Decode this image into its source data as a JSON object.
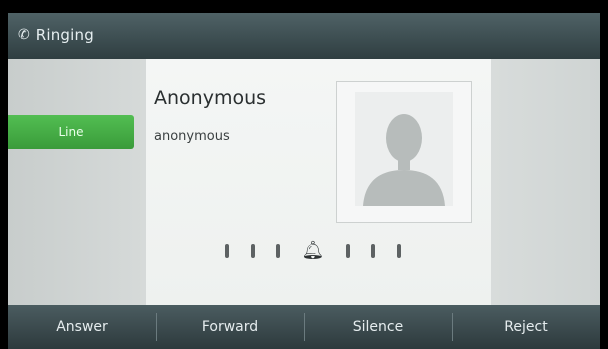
{
  "statusbar": {
    "icon": "phone-icon",
    "title": "Ringing"
  },
  "sidebar": {
    "tab_label": "Line"
  },
  "caller": {
    "name": "Anonymous",
    "number": "anonymous",
    "photo_icon": "contact-silhouette-icon"
  },
  "ring_indicator": {
    "icon": "bell-icon"
  },
  "softkeys": [
    "Answer",
    "Forward",
    "Silence",
    "Reject"
  ],
  "colors": {
    "statusbar": "#3b4c50",
    "tab_active": "#47ad47",
    "softkey_bar": "#3a4a4e",
    "card": "#f2f4f3"
  }
}
